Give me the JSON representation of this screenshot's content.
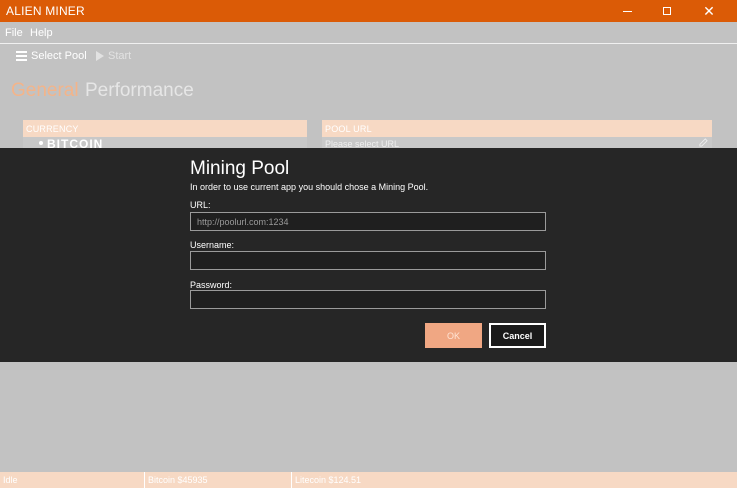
{
  "window": {
    "title": "ALIEN MINER",
    "accent_color": "#db5b06"
  },
  "menu": {
    "file": "File",
    "help": "Help"
  },
  "toolbar": {
    "select_pool": "Select Pool",
    "start": "Start"
  },
  "tabs": {
    "general": "General",
    "performance": "Performance"
  },
  "panels": {
    "currency": {
      "header": "CURRENCY",
      "selected": "BITCOIN"
    },
    "pool": {
      "header": "POOL URL",
      "value": "Please select URL"
    }
  },
  "dialog": {
    "title": "Mining Pool",
    "subtitle": "In order to use current app you should chose a Mining Pool.",
    "url_label": "URL:",
    "url_placeholder": "http://poolurl.com:1234",
    "username_label": "Username:",
    "username_value": "",
    "password_label": "Password:",
    "password_value": "",
    "ok_label": "OK",
    "cancel_label": "Cancel"
  },
  "status": {
    "state": "Idle",
    "bitcoin": "Bitcoin $45935",
    "litecoin": "Litecoin $124.51"
  }
}
